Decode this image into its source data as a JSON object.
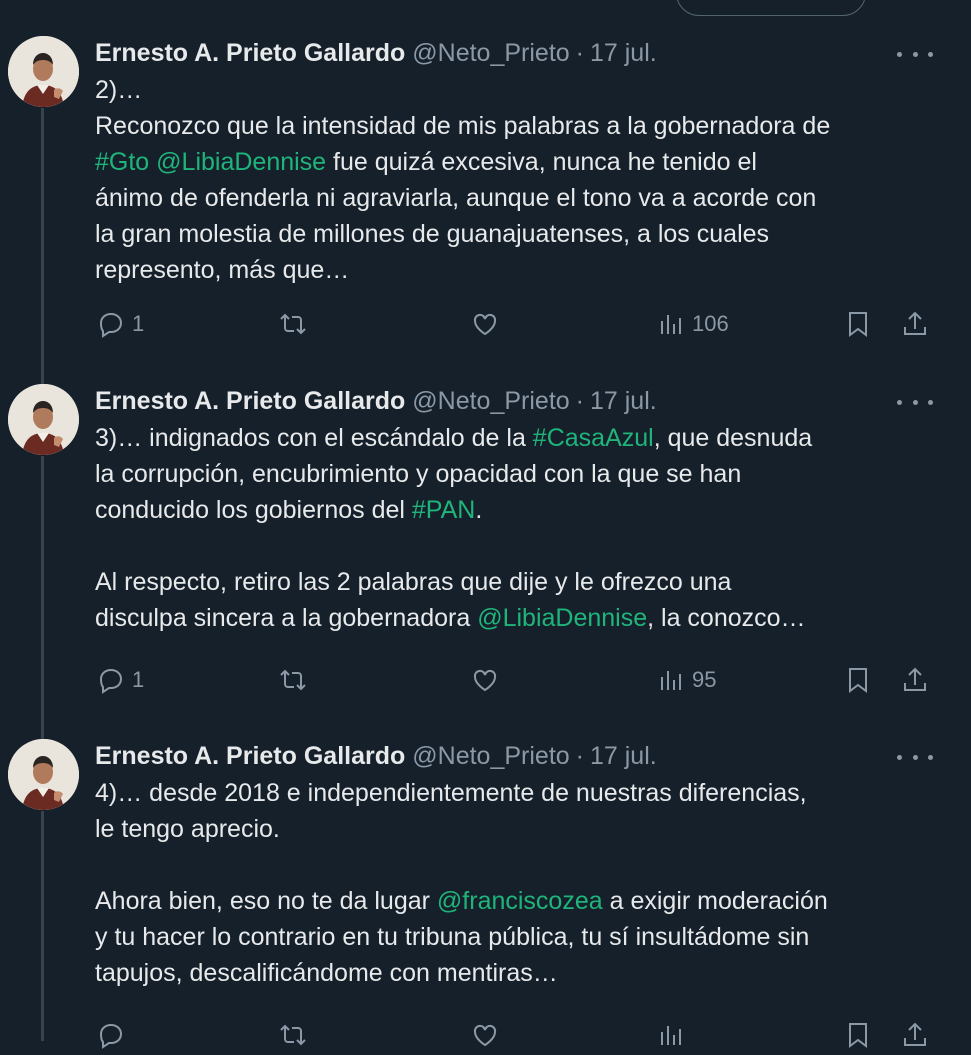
{
  "tweets": [
    {
      "name": "Ernesto A. Prieto Gallardo",
      "handle": "@Neto_Prieto",
      "separator": "·",
      "date": "17 jul.",
      "lines": [
        [
          {
            "t": "2)…"
          }
        ],
        [
          {
            "t": "Reconozco que la intensidad de mis palabras a la gobernadora de"
          }
        ],
        [
          {
            "t": "#Gto",
            "link": true
          },
          {
            "t": " "
          },
          {
            "t": "@LibiaDennise",
            "link": true
          },
          {
            "t": " fue quizá excesiva, nunca he tenido el"
          }
        ],
        [
          {
            "t": "ánimo de ofenderla ni agraviarla, aunque el tono va a acorde con"
          }
        ],
        [
          {
            "t": "la gran molestia de millones de guanajuatenses, a los cuales"
          }
        ],
        [
          {
            "t": "represento, más que…"
          }
        ]
      ],
      "replies": "1",
      "retweets": "",
      "likes": "",
      "views": "106"
    },
    {
      "name": "Ernesto A. Prieto Gallardo",
      "handle": "@Neto_Prieto",
      "separator": "·",
      "date": "17 jul.",
      "lines": [
        [
          {
            "t": "3)… indignados con el escándalo de la "
          },
          {
            "t": "#CasaAzul",
            "link": true
          },
          {
            "t": ", que desnuda"
          }
        ],
        [
          {
            "t": "la corrupción, encubrimiento y opacidad con la que se han"
          }
        ],
        [
          {
            "t": "conducido los gobiernos del "
          },
          {
            "t": "#PAN",
            "link": true
          },
          {
            "t": "."
          }
        ],
        [],
        [
          {
            "t": "Al respecto, retiro las 2 palabras que dije y le ofrezco una"
          }
        ],
        [
          {
            "t": "disculpa sincera a la gobernadora "
          },
          {
            "t": "@LibiaDennise",
            "link": true
          },
          {
            "t": ", la conozco…"
          }
        ]
      ],
      "replies": "1",
      "retweets": "",
      "likes": "",
      "views": "95"
    },
    {
      "name": "Ernesto A. Prieto Gallardo",
      "handle": "@Neto_Prieto",
      "separator": "·",
      "date": "17 jul.",
      "lines": [
        [
          {
            "t": "4)… desde 2018 e independientemente de nuestras diferencias,"
          }
        ],
        [
          {
            "t": "le tengo aprecio."
          }
        ],
        [],
        [
          {
            "t": "Ahora bien, eso no te da lugar "
          },
          {
            "t": "@franciscozea",
            "link": true
          },
          {
            "t": " a exigir moderación"
          }
        ],
        [
          {
            "t": "y tu hacer lo contrario en tu tribuna pública, tu sí insultádome sin"
          }
        ],
        [
          {
            "t": "tapujos, descalificándome con mentiras…"
          }
        ]
      ],
      "replies": "",
      "retweets": "",
      "likes": "",
      "views": ""
    }
  ],
  "colors": {
    "background": "#15202b",
    "text": "#e7e9ea",
    "muted": "#8b98a5",
    "link": "#1fb57a",
    "thread_line": "#38444d"
  },
  "icons": [
    "reply-icon",
    "retweet-icon",
    "like-icon",
    "views-icon",
    "bookmark-icon",
    "share-icon",
    "more-icon"
  ]
}
